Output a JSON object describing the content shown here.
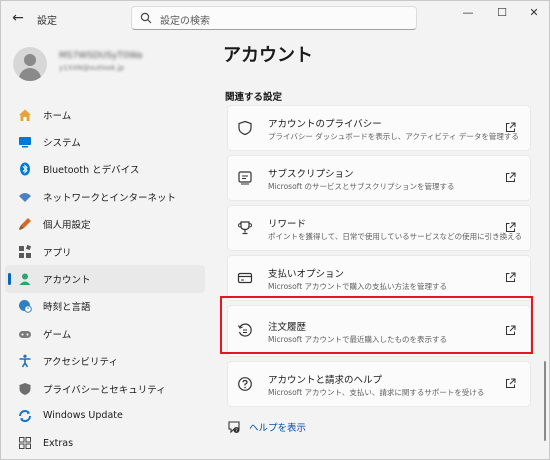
{
  "window": {
    "back_glyph": "←",
    "app_title": "設定",
    "search_placeholder": "設定の検索",
    "controls": {
      "minimize": "—",
      "maximize": "☐",
      "close": "✕"
    }
  },
  "profile": {
    "name": "MS7WSDUSyT0Wa",
    "email": "y1XXN@outlook.jp"
  },
  "sidebar": {
    "items": [
      {
        "label": "ホーム",
        "icon": "home-icon",
        "color": "#e8a23a"
      },
      {
        "label": "システム",
        "icon": "monitor-icon",
        "color": "#0078d4"
      },
      {
        "label": "Bluetooth とデバイス",
        "icon": "bluetooth-icon",
        "color": "#0078d4"
      },
      {
        "label": "ネットワークとインターネット",
        "icon": "wifi-icon",
        "color": "#4a7fc1"
      },
      {
        "label": "個人用設定",
        "icon": "brush-icon",
        "color": "#d06b2c"
      },
      {
        "label": "アプリ",
        "icon": "apps-icon",
        "color": "#5a5a5a"
      },
      {
        "label": "アカウント",
        "icon": "account-icon",
        "color": "#2aa56e",
        "active": true
      },
      {
        "label": "時刻と言語",
        "icon": "globe-clock-icon",
        "color": "#2f7fc1"
      },
      {
        "label": "ゲーム",
        "icon": "gamepad-icon",
        "color": "#7a7a7a"
      },
      {
        "label": "アクセシビリティ",
        "icon": "accessibility-icon",
        "color": "#1f6fb8"
      },
      {
        "label": "プライバシーとセキュリティ",
        "icon": "shield-icon",
        "color": "#6e6e6e"
      },
      {
        "label": "Windows Update",
        "icon": "update-icon",
        "color": "#1a73c9"
      },
      {
        "label": "Extras",
        "icon": "extras-icon",
        "color": "#444444"
      }
    ]
  },
  "main": {
    "title": "アカウント",
    "section_title": "関連する設定",
    "cards": [
      {
        "title": "アカウントのプライバシー",
        "subtitle": "プライバシー ダッシュボードを表示し、アクティビティ データを管理する",
        "icon": "shield-outline-icon"
      },
      {
        "title": "サブスクリプション",
        "subtitle": "Microsoft のサービスとサブスクリプションを管理する",
        "icon": "subscription-icon"
      },
      {
        "title": "リワード",
        "subtitle": "ポイントを獲得して、日常で使用しているサービスなどの使用に引き換える",
        "icon": "trophy-icon"
      },
      {
        "title": "支払いオプション",
        "subtitle": "Microsoft アカウントで購入の支払い方法を管理する",
        "icon": "credit-card-icon"
      },
      {
        "title": "注文履歴",
        "subtitle": "Microsoft アカウントで最近購入したものを表示する",
        "icon": "history-icon"
      },
      {
        "title": "アカウントと請求のヘルプ",
        "subtitle": "Microsoft アカウント、支払い、請求に関するサポートを受ける",
        "icon": "help-circle-icon"
      }
    ],
    "help_label": "ヘルプを表示",
    "highlight_color": "#e4161f"
  }
}
